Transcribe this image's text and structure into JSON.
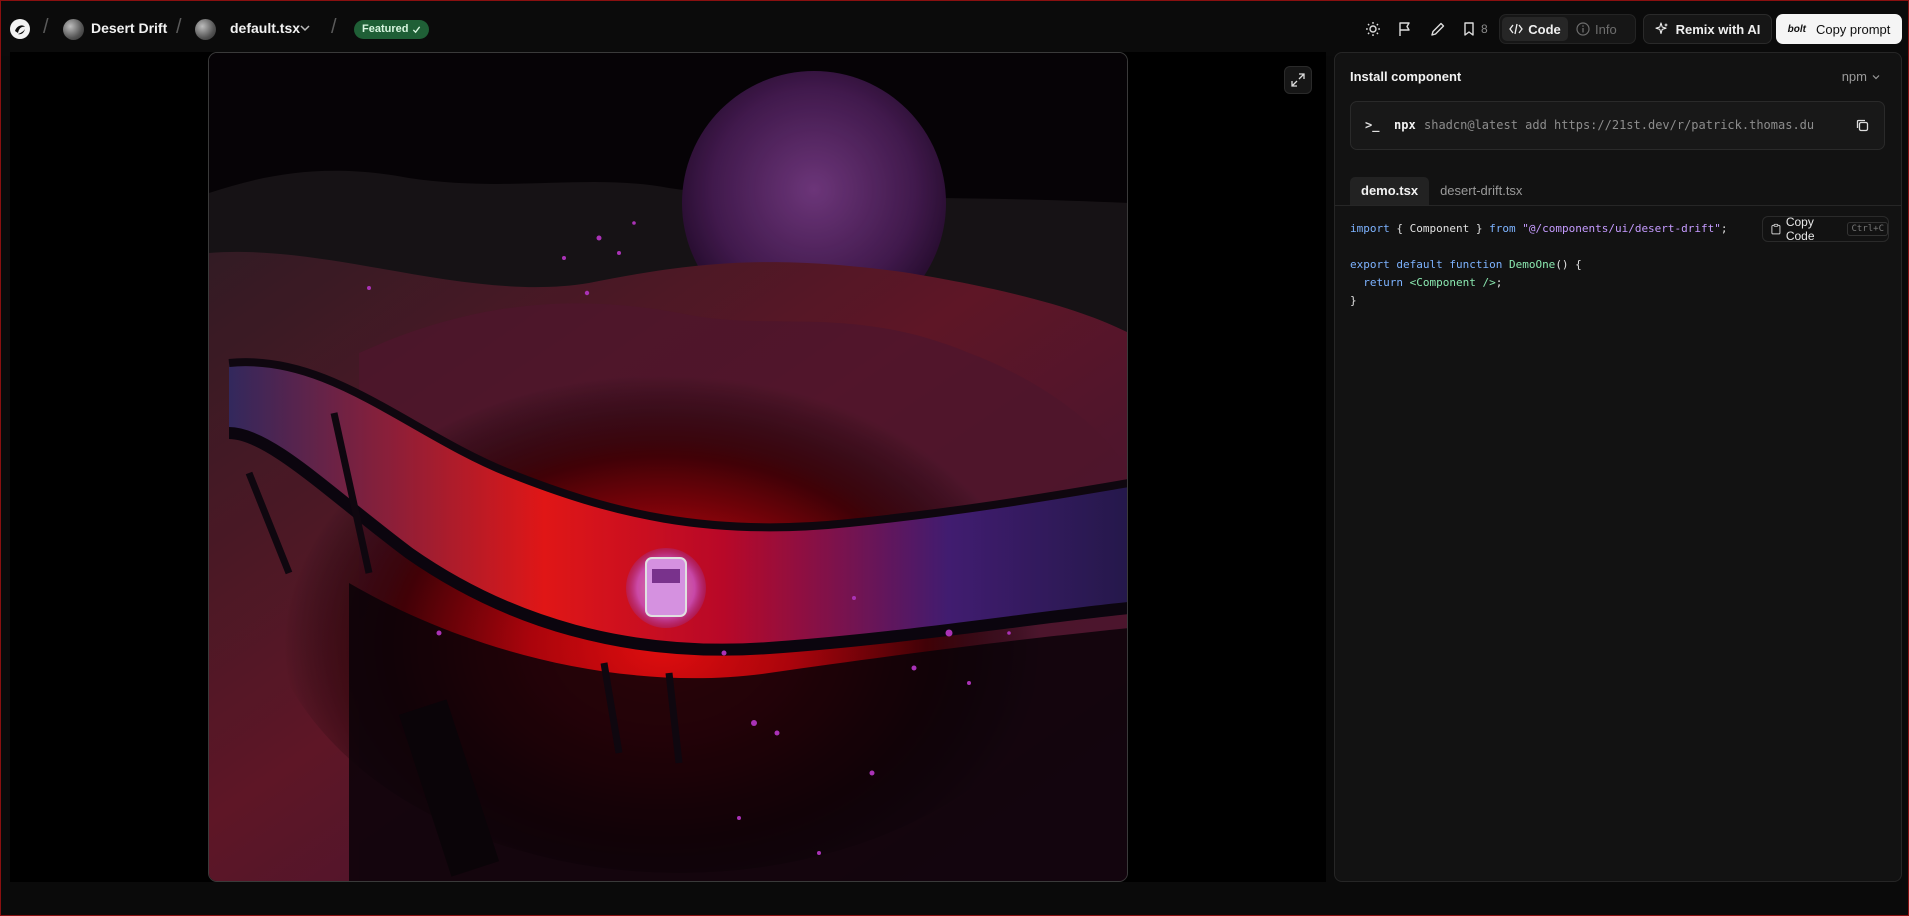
{
  "header": {
    "project_name": "Desert Drift",
    "file_name": "default.tsx",
    "featured_label": "Featured",
    "bookmark_count": "8",
    "code_label": "Code",
    "info_label": "Info",
    "remix_label": "Remix with AI",
    "bolt_label": "bolt",
    "copy_prompt_label": "Copy prompt"
  },
  "panel": {
    "install_title": "Install component",
    "package_manager": "npm",
    "command_prompt": ">_",
    "command_tool": "npx",
    "command_args": "shadcn@latest add https://21st.dev/r/patrick.thomas.du",
    "tabs": [
      {
        "label": "demo.tsx",
        "active": true
      },
      {
        "label": "desert-drift.tsx",
        "active": false
      }
    ],
    "copy_code_label": "Copy Code",
    "copy_code_shortcut": "Ctrl+C",
    "code": {
      "l1_import": "import",
      "l1_open": " { ",
      "l1_component": "Component",
      "l1_close": " } ",
      "l1_from": "from",
      "l1_path": " \"@/components/ui/desert-drift\"",
      "l1_semi": ";",
      "l3_export": "export default function",
      "l3_name": " DemoOne",
      "l3_rest": "() {",
      "l4_return": "  return",
      "l4_tag": " <Component />",
      "l4_semi": ";",
      "l5": "}"
    }
  },
  "colors": {
    "accent_green": "#1f5f36",
    "background": "#0a0a0a",
    "panel": "#121212"
  }
}
